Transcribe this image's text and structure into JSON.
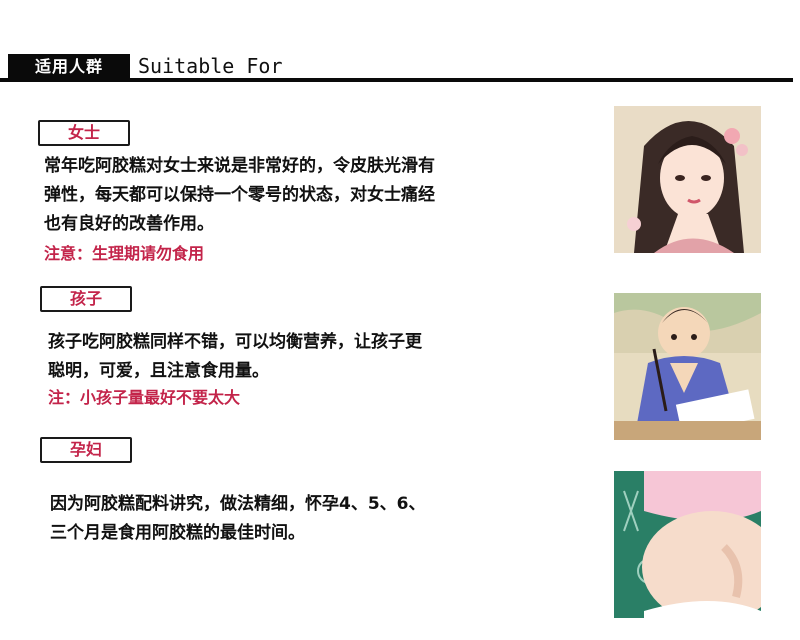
{
  "header": {
    "label_cn": "适用人群",
    "label_en": "Suitable For"
  },
  "sections": [
    {
      "label": "女士",
      "lines": [
        "常年吃阿胶糕对女士来说是非常好的，令皮肤光滑有",
        "弹性，每天都可以保持一个零号的状态，对女士痛经",
        "也有良好的改善作用。"
      ],
      "note": "注意：生理期请勿食用"
    },
    {
      "label": "孩子",
      "lines": [
        "孩子吃阿胶糕同样不错，可以均衡营养，让孩子更",
        "聪明，可爱，且注意食用量。"
      ],
      "note": "注：小孩子量最好不要太大"
    },
    {
      "label": "孕妇",
      "lines": [
        "因为阿胶糕配料讲究，做法精细，怀孕4、5、6、",
        "三个月是食用阿胶糕的最佳时间。"
      ],
      "note": ""
    }
  ],
  "colors": {
    "accent": "#c3244a",
    "text": "#111111",
    "header_bg": "#0a0a0a"
  }
}
